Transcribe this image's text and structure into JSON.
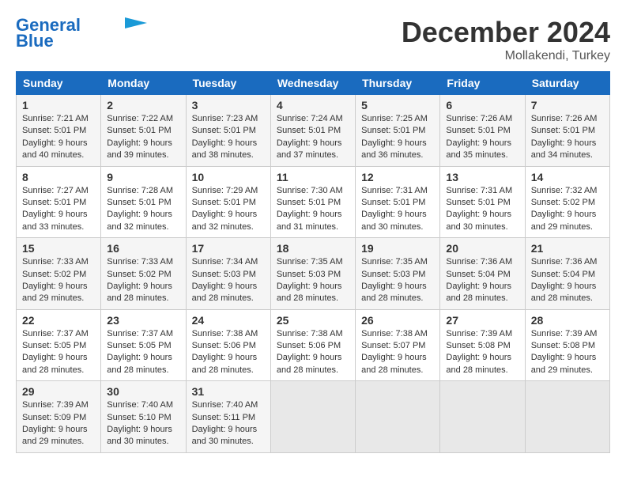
{
  "header": {
    "logo_line1": "General",
    "logo_line2": "Blue",
    "title": "December 2024",
    "subtitle": "Mollakendi, Turkey"
  },
  "days_of_week": [
    "Sunday",
    "Monday",
    "Tuesday",
    "Wednesday",
    "Thursday",
    "Friday",
    "Saturday"
  ],
  "weeks": [
    [
      {
        "day": "1",
        "text": "Sunrise: 7:21 AM\nSunset: 5:01 PM\nDaylight: 9 hours\nand 40 minutes."
      },
      {
        "day": "2",
        "text": "Sunrise: 7:22 AM\nSunset: 5:01 PM\nDaylight: 9 hours\nand 39 minutes."
      },
      {
        "day": "3",
        "text": "Sunrise: 7:23 AM\nSunset: 5:01 PM\nDaylight: 9 hours\nand 38 minutes."
      },
      {
        "day": "4",
        "text": "Sunrise: 7:24 AM\nSunset: 5:01 PM\nDaylight: 9 hours\nand 37 minutes."
      },
      {
        "day": "5",
        "text": "Sunrise: 7:25 AM\nSunset: 5:01 PM\nDaylight: 9 hours\nand 36 minutes."
      },
      {
        "day": "6",
        "text": "Sunrise: 7:26 AM\nSunset: 5:01 PM\nDaylight: 9 hours\nand 35 minutes."
      },
      {
        "day": "7",
        "text": "Sunrise: 7:26 AM\nSunset: 5:01 PM\nDaylight: 9 hours\nand 34 minutes."
      }
    ],
    [
      {
        "day": "8",
        "text": "Sunrise: 7:27 AM\nSunset: 5:01 PM\nDaylight: 9 hours\nand 33 minutes."
      },
      {
        "day": "9",
        "text": "Sunrise: 7:28 AM\nSunset: 5:01 PM\nDaylight: 9 hours\nand 32 minutes."
      },
      {
        "day": "10",
        "text": "Sunrise: 7:29 AM\nSunset: 5:01 PM\nDaylight: 9 hours\nand 32 minutes."
      },
      {
        "day": "11",
        "text": "Sunrise: 7:30 AM\nSunset: 5:01 PM\nDaylight: 9 hours\nand 31 minutes."
      },
      {
        "day": "12",
        "text": "Sunrise: 7:31 AM\nSunset: 5:01 PM\nDaylight: 9 hours\nand 30 minutes."
      },
      {
        "day": "13",
        "text": "Sunrise: 7:31 AM\nSunset: 5:01 PM\nDaylight: 9 hours\nand 30 minutes."
      },
      {
        "day": "14",
        "text": "Sunrise: 7:32 AM\nSunset: 5:02 PM\nDaylight: 9 hours\nand 29 minutes."
      }
    ],
    [
      {
        "day": "15",
        "text": "Sunrise: 7:33 AM\nSunset: 5:02 PM\nDaylight: 9 hours\nand 29 minutes."
      },
      {
        "day": "16",
        "text": "Sunrise: 7:33 AM\nSunset: 5:02 PM\nDaylight: 9 hours\nand 28 minutes."
      },
      {
        "day": "17",
        "text": "Sunrise: 7:34 AM\nSunset: 5:03 PM\nDaylight: 9 hours\nand 28 minutes."
      },
      {
        "day": "18",
        "text": "Sunrise: 7:35 AM\nSunset: 5:03 PM\nDaylight: 9 hours\nand 28 minutes."
      },
      {
        "day": "19",
        "text": "Sunrise: 7:35 AM\nSunset: 5:03 PM\nDaylight: 9 hours\nand 28 minutes."
      },
      {
        "day": "20",
        "text": "Sunrise: 7:36 AM\nSunset: 5:04 PM\nDaylight: 9 hours\nand 28 minutes."
      },
      {
        "day": "21",
        "text": "Sunrise: 7:36 AM\nSunset: 5:04 PM\nDaylight: 9 hours\nand 28 minutes."
      }
    ],
    [
      {
        "day": "22",
        "text": "Sunrise: 7:37 AM\nSunset: 5:05 PM\nDaylight: 9 hours\nand 28 minutes."
      },
      {
        "day": "23",
        "text": "Sunrise: 7:37 AM\nSunset: 5:05 PM\nDaylight: 9 hours\nand 28 minutes."
      },
      {
        "day": "24",
        "text": "Sunrise: 7:38 AM\nSunset: 5:06 PM\nDaylight: 9 hours\nand 28 minutes."
      },
      {
        "day": "25",
        "text": "Sunrise: 7:38 AM\nSunset: 5:06 PM\nDaylight: 9 hours\nand 28 minutes."
      },
      {
        "day": "26",
        "text": "Sunrise: 7:38 AM\nSunset: 5:07 PM\nDaylight: 9 hours\nand 28 minutes."
      },
      {
        "day": "27",
        "text": "Sunrise: 7:39 AM\nSunset: 5:08 PM\nDaylight: 9 hours\nand 28 minutes."
      },
      {
        "day": "28",
        "text": "Sunrise: 7:39 AM\nSunset: 5:08 PM\nDaylight: 9 hours\nand 29 minutes."
      }
    ],
    [
      {
        "day": "29",
        "text": "Sunrise: 7:39 AM\nSunset: 5:09 PM\nDaylight: 9 hours\nand 29 minutes."
      },
      {
        "day": "30",
        "text": "Sunrise: 7:40 AM\nSunset: 5:10 PM\nDaylight: 9 hours\nand 30 minutes."
      },
      {
        "day": "31",
        "text": "Sunrise: 7:40 AM\nSunset: 5:11 PM\nDaylight: 9 hours\nand 30 minutes."
      },
      {
        "day": "",
        "text": ""
      },
      {
        "day": "",
        "text": ""
      },
      {
        "day": "",
        "text": ""
      },
      {
        "day": "",
        "text": ""
      }
    ]
  ]
}
